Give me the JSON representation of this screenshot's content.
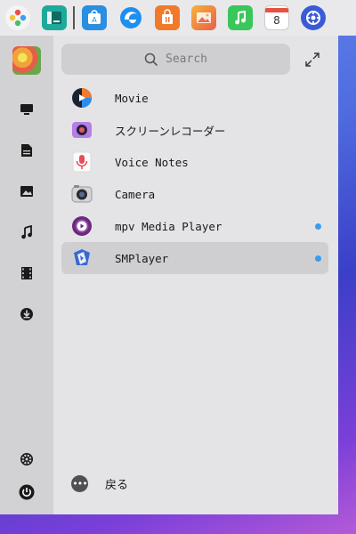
{
  "dock": {
    "items": [
      {
        "name": "launchpad-icon"
      },
      {
        "name": "file-manager-icon"
      },
      {
        "name": "app-store-icon"
      },
      {
        "name": "browser-icon"
      },
      {
        "name": "shopping-icon"
      },
      {
        "name": "photos-icon"
      },
      {
        "name": "music-icon"
      },
      {
        "name": "calendar-icon",
        "text": "8"
      },
      {
        "name": "settings-icon"
      }
    ]
  },
  "sidebar": {
    "items": [
      {
        "name": "all-apps-icon"
      },
      {
        "name": "documents-icon"
      },
      {
        "name": "pictures-icon"
      },
      {
        "name": "music-category-icon"
      },
      {
        "name": "video-icon"
      },
      {
        "name": "downloads-icon"
      },
      {
        "name": "system-settings-icon"
      },
      {
        "name": "power-icon"
      }
    ]
  },
  "search": {
    "placeholder": "Search"
  },
  "apps": [
    {
      "label": "Movie",
      "new": false,
      "selected": false
    },
    {
      "label": "スクリーンレコーダー",
      "new": false,
      "selected": false
    },
    {
      "label": "Voice Notes",
      "new": false,
      "selected": false
    },
    {
      "label": "Camera",
      "new": false,
      "selected": false
    },
    {
      "label": "mpv Media Player",
      "new": true,
      "selected": false
    },
    {
      "label": "SMPlayer",
      "new": true,
      "selected": true
    }
  ],
  "bottom": {
    "back_label": "戻る"
  },
  "colors": {
    "accent_dot": "#3a9cf0",
    "launcher_bg": "#e4e4e6",
    "sidebar_bg": "#d2d2d4"
  }
}
